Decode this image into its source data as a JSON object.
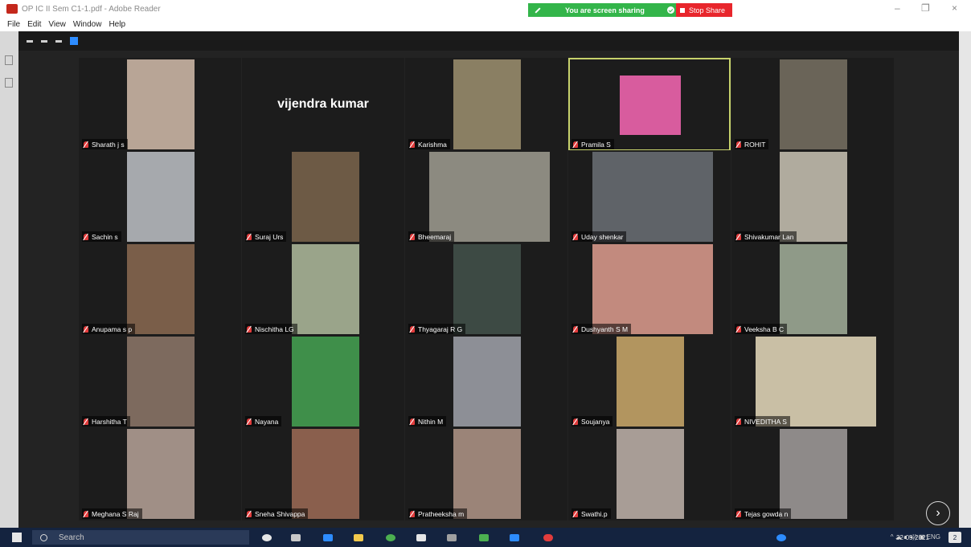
{
  "window": {
    "title": "OP IC II Sem C1-1.pdf - Adobe Reader",
    "minimize": "–",
    "maximize": "❐",
    "close": "×"
  },
  "share_banner": {
    "message": "You are screen sharing",
    "stop_label": "Stop Share"
  },
  "menu": {
    "items": [
      "File",
      "Edit",
      "View",
      "Window",
      "Help"
    ]
  },
  "participants": [
    {
      "name": "Sharath j s",
      "color": "#b8a596"
    },
    {
      "name": "vijendra kumar",
      "color": ""
    },
    {
      "name": "Karishma",
      "color": "#8a7f63"
    },
    {
      "name": "Pramila S",
      "color": "#d85c9e"
    },
    {
      "name": "ROHIT",
      "color": "#6a6458"
    },
    {
      "name": "Sachin s",
      "color": "#a6a9ad"
    },
    {
      "name": "Suraj Urs",
      "color": "#6d5a45"
    },
    {
      "name": "Bheemaraj",
      "color": "#8c8a80"
    },
    {
      "name": "Uday shenkar",
      "color": "#5f6368"
    },
    {
      "name": "Shivakumar Lan",
      "color": "#b0ab9e"
    },
    {
      "name": "Anupama s p",
      "color": "#7a5e49"
    },
    {
      "name": "Nischitha LG",
      "color": "#9aa48a"
    },
    {
      "name": "Thyagaraj R G",
      "color": "#3d4a44"
    },
    {
      "name": "Dushyanth S M",
      "color": "#c28a7e"
    },
    {
      "name": "Veeksha B C",
      "color": "#8f9a88"
    },
    {
      "name": "Harshitha T",
      "color": "#7d6a5e"
    },
    {
      "name": "Nayana",
      "color": "#3f8f4a"
    },
    {
      "name": "Nithin M",
      "color": "#8d8f96"
    },
    {
      "name": "Soujanya",
      "color": "#b2955f"
    },
    {
      "name": "NIVEDITHA S",
      "color": "#c9bfa5"
    },
    {
      "name": "Meghana S Raj",
      "color": "#a08f86"
    },
    {
      "name": "Sneha Shivappa",
      "color": "#8a5f4d"
    },
    {
      "name": "Pratheeksha m",
      "color": "#9b8478"
    },
    {
      "name": "Swathi.p",
      "color": "#a89d96"
    },
    {
      "name": "Tejas gowda n",
      "color": "#8e8a89"
    }
  ],
  "taskbar": {
    "search_placeholder": "Search",
    "tray": "^ ☁ ∎ ◂)) ▣ ENG",
    "date": "22-05-2021",
    "notifications": "2"
  },
  "next_page_icon": "›"
}
